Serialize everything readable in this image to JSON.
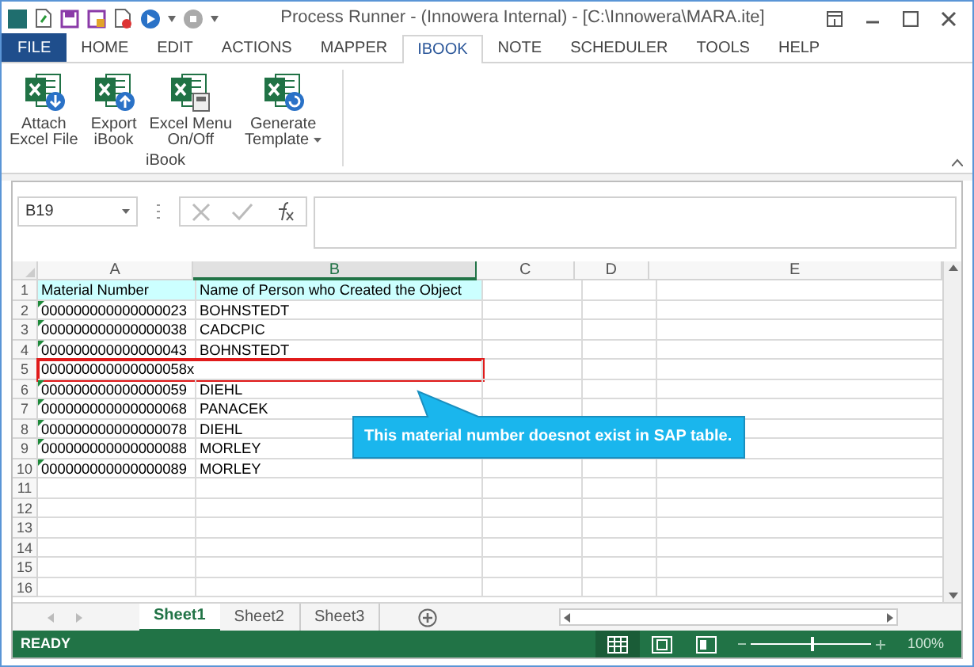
{
  "window": {
    "title": "Process Runner - (Innowera Internal) - [C:\\Innowera\\MARA.ite]"
  },
  "menu_tabs": [
    {
      "label": "FILE",
      "kind": "file",
      "selected": false
    },
    {
      "label": "HOME",
      "kind": "tab",
      "selected": false
    },
    {
      "label": "EDIT",
      "kind": "tab",
      "selected": false
    },
    {
      "label": "ACTIONS",
      "kind": "tab",
      "selected": false
    },
    {
      "label": "MAPPER",
      "kind": "tab",
      "selected": false
    },
    {
      "label": "IBOOK",
      "kind": "tab",
      "selected": true
    },
    {
      "label": "NOTE",
      "kind": "tab",
      "selected": false
    },
    {
      "label": "SCHEDULER",
      "kind": "tab",
      "selected": false
    },
    {
      "label": "TOOLS",
      "kind": "tab",
      "selected": false
    },
    {
      "label": "HELP",
      "kind": "tab",
      "selected": false
    }
  ],
  "ribbon": {
    "group": "iBook",
    "buttons": [
      {
        "lines": [
          "Attach",
          "Excel File"
        ],
        "kind": "attach",
        "dropdown": false
      },
      {
        "lines": [
          "Export",
          "iBook"
        ],
        "kind": "export",
        "dropdown": false
      },
      {
        "lines": [
          "Excel Menu",
          "On/Off"
        ],
        "kind": "menu",
        "dropdown": false
      },
      {
        "lines": [
          "Generate",
          "Template"
        ],
        "kind": "template",
        "dropdown": true
      }
    ]
  },
  "formula_bar": {
    "name_box": "B19"
  },
  "sheet": {
    "columns": [
      {
        "label": "A",
        "selected": false
      },
      {
        "label": "B",
        "selected": true
      },
      {
        "label": "C",
        "selected": false
      },
      {
        "label": "D",
        "selected": false
      },
      {
        "label": "E",
        "selected": false
      }
    ],
    "rows": [
      {
        "number": "1",
        "kind": "header",
        "cells": [
          "Material Number",
          "Name of Person who Created the Object"
        ],
        "flagged": false,
        "highlighted": false
      },
      {
        "number": "2",
        "kind": "data",
        "cells": [
          "000000000000000023",
          "BOHNSTEDT"
        ],
        "flagged": true,
        "highlighted": false
      },
      {
        "number": "3",
        "kind": "data",
        "cells": [
          "000000000000000038",
          "CADCPIC"
        ],
        "flagged": true,
        "highlighted": false
      },
      {
        "number": "4",
        "kind": "data",
        "cells": [
          "000000000000000043",
          "BOHNSTEDT"
        ],
        "flagged": true,
        "highlighted": false
      },
      {
        "number": "5",
        "kind": "data",
        "cells": [
          "000000000000000058x"
        ],
        "flagged": false,
        "highlighted": true
      },
      {
        "number": "6",
        "kind": "data",
        "cells": [
          "000000000000000059",
          "DIEHL"
        ],
        "flagged": true,
        "highlighted": false
      },
      {
        "number": "7",
        "kind": "data",
        "cells": [
          "000000000000000068",
          "PANACEK"
        ],
        "flagged": true,
        "highlighted": false
      },
      {
        "number": "8",
        "kind": "data",
        "cells": [
          "000000000000000078",
          "DIEHL"
        ],
        "flagged": true,
        "highlighted": false
      },
      {
        "number": "9",
        "kind": "data",
        "cells": [
          "000000000000000088",
          "MORLEY"
        ],
        "flagged": true,
        "highlighted": false
      },
      {
        "number": "10",
        "kind": "data",
        "cells": [
          "000000000000000089",
          "MORLEY"
        ],
        "flagged": true,
        "highlighted": false
      },
      {
        "number": "11",
        "kind": "data",
        "cells": [],
        "flagged": false,
        "highlighted": false
      },
      {
        "number": "12",
        "kind": "data",
        "cells": [],
        "flagged": false,
        "highlighted": false
      },
      {
        "number": "13",
        "kind": "data",
        "cells": [],
        "flagged": false,
        "highlighted": false
      },
      {
        "number": "14",
        "kind": "data",
        "cells": [],
        "flagged": false,
        "highlighted": false
      },
      {
        "number": "15",
        "kind": "data",
        "cells": [],
        "flagged": false,
        "highlighted": false
      },
      {
        "number": "16",
        "kind": "data",
        "cells": [],
        "flagged": false,
        "highlighted": false
      }
    ]
  },
  "callout": {
    "text": "This material number doesnot exist in SAP table."
  },
  "sheet_tabs": [
    {
      "label": "Sheet1",
      "selected": true
    },
    {
      "label": "Sheet2",
      "selected": false
    },
    {
      "label": "Sheet3",
      "selected": false
    }
  ],
  "status_bar": {
    "status": "READY",
    "views": [
      {
        "kind": "normal",
        "selected": true
      },
      {
        "kind": "page_layout",
        "selected": false
      },
      {
        "kind": "page_break",
        "selected": false
      }
    ],
    "zoom": {
      "level": 0.5,
      "reading": "100%"
    }
  }
}
